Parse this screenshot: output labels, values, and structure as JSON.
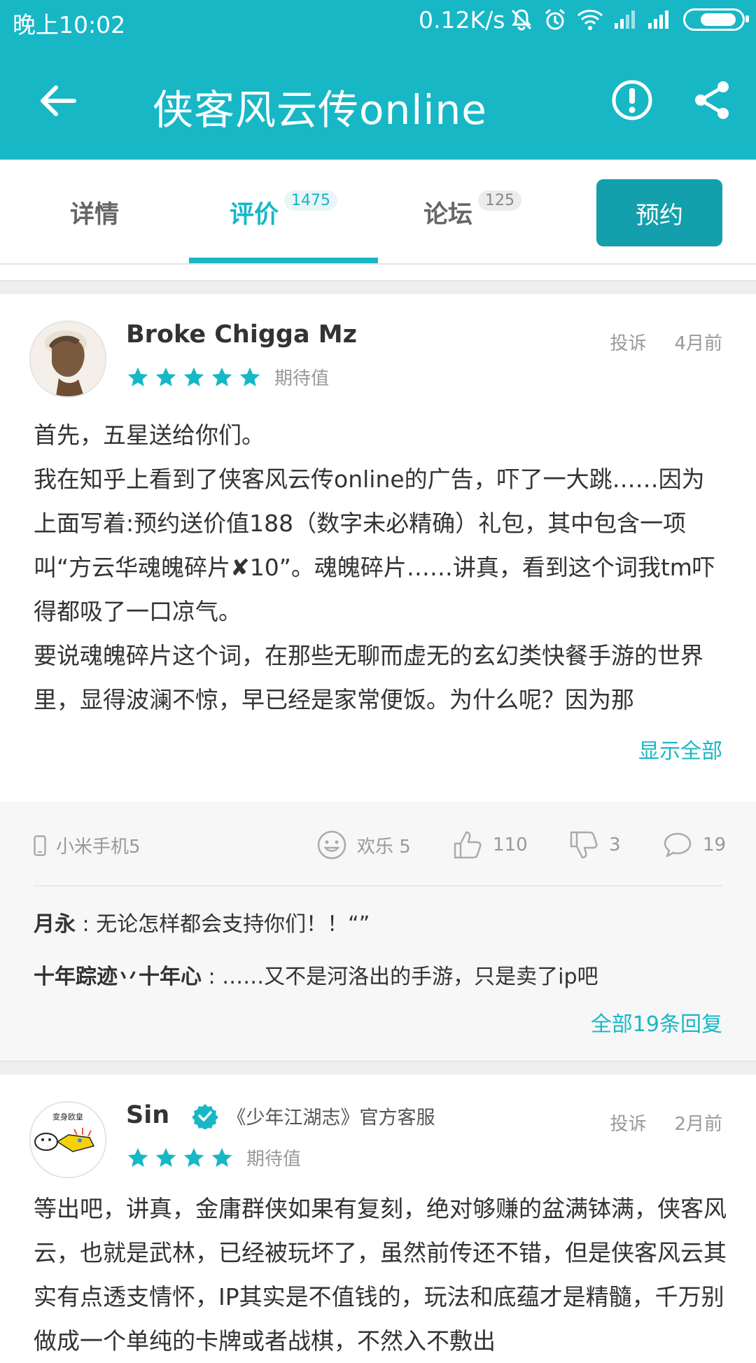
{
  "status_bar": {
    "time": "晚上10:02",
    "speed": "0.12K/s"
  },
  "toolbar": {
    "title": "侠客风云传online",
    "back_icon": "back-arrow-icon",
    "report_icon": "alert-icon",
    "share_icon": "share-icon"
  },
  "tabs": [
    {
      "label": "详情"
    },
    {
      "label": "评价",
      "count": "1475"
    },
    {
      "label": "论坛",
      "count": "125"
    }
  ],
  "reserve_button": "预约",
  "accent_color": "#17b7c6",
  "reviews": [
    {
      "user": "Broke Chigga Mz",
      "rating": 5,
      "rating_label": "期待值",
      "report": "投诉",
      "time": "4月前",
      "paragraphs": [
        "首先，五星送给你们。",
        "我在知乎上看到了侠客风云传online的广告，吓了一大跳……因为上面写着:预约送价值188（数字未必精确）礼包，其中包含一项叫“方云华魂魄碎片✘10”。魂魄碎片……讲真，看到这个词我tm吓得都吸了一口凉气。",
        "要说魂魄碎片这个词，在那些无聊而虚无的玄幻类快餐手游的世界里，显得波澜不惊，早已经是家常便饭。为什么呢？因为那"
      ],
      "show_all": "显示全部",
      "device": "小米手机5",
      "mood": "欢乐 5",
      "likes": "110",
      "dislikes": "3",
      "comments": "19",
      "replies": [
        {
          "name": "月永",
          "text": " : 无论怎样都会支持你们！！“”"
        },
        {
          "name": "十年踪迹丷十年心",
          "text": " : ……又不是河洛出的手游，只是卖了ip吧"
        }
      ],
      "all_replies": "全部19条回复"
    },
    {
      "user": "Sin",
      "badge": "《少年江湖志》官方客服",
      "avatar_text": "变身欧皇",
      "rating": 4,
      "rating_label": "期待值",
      "report": "投诉",
      "time": "2月前",
      "paragraphs": [
        "等出吧，讲真，金庸群侠如果有复刻，绝对够赚的盆满钵满，侠客风云，也就是武林，已经被玩坏了，虽然前传还不错，但是侠客风云其实有点透支情怀，IP其实是不值钱的，玩法和底蕴才是精髓，千万别做成一个单纯的卡牌或者战棋，不然入不敷出"
      ]
    }
  ]
}
